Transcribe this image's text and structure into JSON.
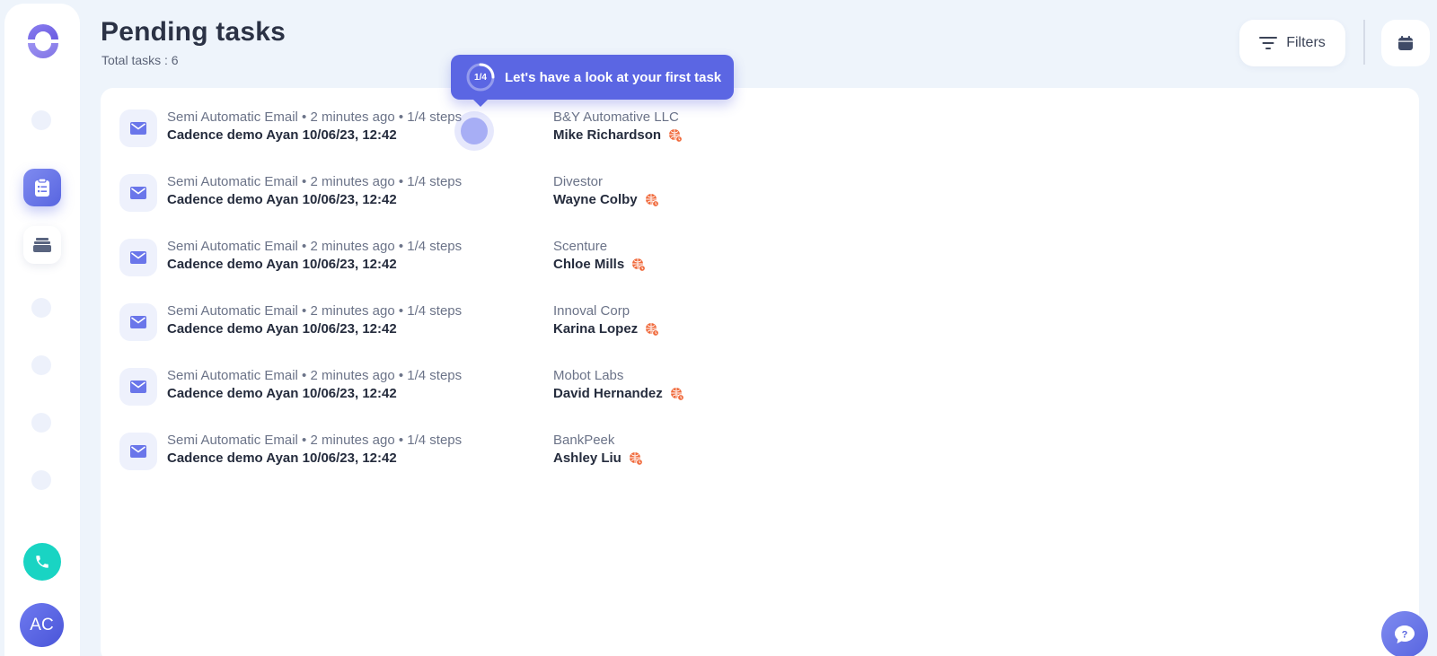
{
  "sidebar": {
    "avatar_initials": "AC"
  },
  "header": {
    "title": "Pending tasks",
    "subtitle": "Total tasks : 6",
    "filters_label": "Filters"
  },
  "tour": {
    "step": "1/4",
    "step_progress": 0.25,
    "message": "Let's have a look at your first task"
  },
  "tasks": [
    {
      "meta": "Semi Automatic Email • 2 minutes ago • 1/4 steps",
      "name": "Cadence demo Ayan 10/06/23, 12:42",
      "company": "B&Y Automative LLC",
      "lead": "Mike Richardson"
    },
    {
      "meta": "Semi Automatic Email • 2 minutes ago • 1/4 steps",
      "name": "Cadence demo Ayan 10/06/23, 12:42",
      "company": "Divestor",
      "lead": "Wayne Colby"
    },
    {
      "meta": "Semi Automatic Email • 2 minutes ago • 1/4 steps",
      "name": "Cadence demo Ayan 10/06/23, 12:42",
      "company": "Scenture",
      "lead": "Chloe Mills"
    },
    {
      "meta": "Semi Automatic Email • 2 minutes ago • 1/4 steps",
      "name": "Cadence demo Ayan 10/06/23, 12:42",
      "company": "Innoval Corp",
      "lead": "Karina Lopez"
    },
    {
      "meta": "Semi Automatic Email • 2 minutes ago • 1/4 steps",
      "name": "Cadence demo Ayan 10/06/23, 12:42",
      "company": "Mobot Labs",
      "lead": "David Hernandez"
    },
    {
      "meta": "Semi Automatic Email • 2 minutes ago • 1/4 steps",
      "name": "Cadence demo Ayan 10/06/23, 12:42",
      "company": "BankPeek",
      "lead": "Ashley Liu"
    }
  ],
  "icons": {
    "task_type": "mail-icon",
    "lead_badge": "globe-icon",
    "filters": "filter-lines-icon",
    "calendar": "calendar-icon",
    "call": "phone-icon",
    "help": "help-chat-icon"
  },
  "colors": {
    "accent": "#5b66e3",
    "call": "#19d4c3",
    "lead_badge": "#f06a3c"
  }
}
